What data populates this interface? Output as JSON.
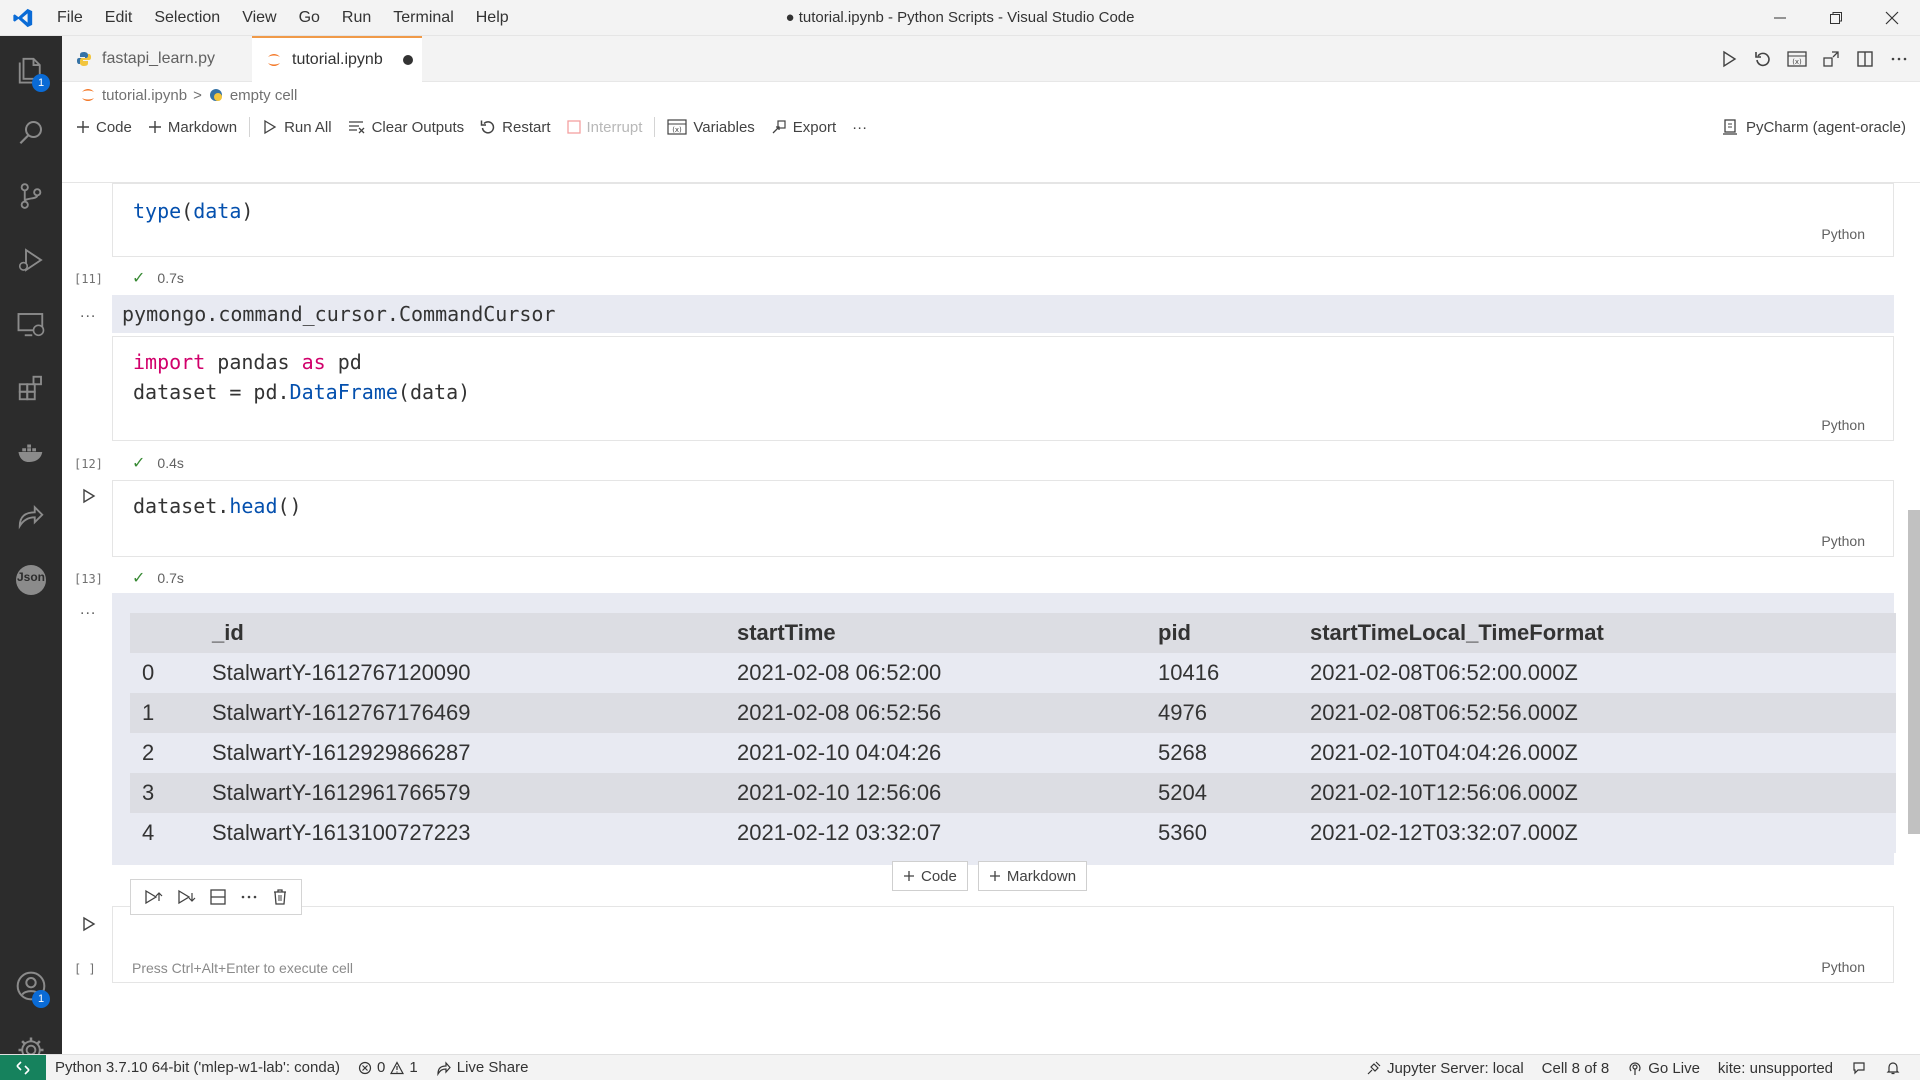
{
  "titlebar": {
    "menu": [
      "File",
      "Edit",
      "Selection",
      "View",
      "Go",
      "Run",
      "Terminal",
      "Help"
    ],
    "window_title": "● tutorial.ipynb - Python Scripts - Visual Studio Code"
  },
  "activity": {
    "explorer_badge": "1",
    "accounts_badge": "1",
    "json_label": "Json"
  },
  "tabs": [
    {
      "label": "fastapi_learn.py",
      "active": false
    },
    {
      "label": "tutorial.ipynb",
      "active": true,
      "dirty": true
    }
  ],
  "breadcrumb": {
    "file": "tutorial.ipynb",
    "sep": ">",
    "cell": "empty cell"
  },
  "toolbar": {
    "code": "Code",
    "markdown": "Markdown",
    "run_all": "Run All",
    "clear_outputs": "Clear Outputs",
    "restart": "Restart",
    "interrupt": "Interrupt",
    "variables": "Variables",
    "export": "Export",
    "more": "···",
    "kernel": "PyCharm (agent-oracle)"
  },
  "cells": [
    {
      "count": "[11]",
      "time": "0.7s",
      "lang": "Python",
      "output": "pymongo.command_cursor.CommandCursor"
    },
    {
      "count": "[12]",
      "time": "0.4s",
      "lang": "Python"
    },
    {
      "count": "[13]",
      "time": "0.7s",
      "lang": "Python"
    },
    {
      "count": "[ ]",
      "placeholder": "Press Ctrl+Alt+Enter to execute cell",
      "lang": "Python"
    }
  ],
  "output_dots": "...",
  "dataframe": {
    "columns": [
      "",
      "_id",
      "startTime",
      "pid",
      "startTimeLocal_TimeFormat"
    ],
    "rows": [
      [
        "0",
        "StalwartY-1612767120090",
        "2021-02-08 06:52:00",
        "10416",
        "2021-02-08T06:52:00.000Z"
      ],
      [
        "1",
        "StalwartY-1612767176469",
        "2021-02-08 06:52:56",
        "4976",
        "2021-02-08T06:52:56.000Z"
      ],
      [
        "2",
        "StalwartY-1612929866287",
        "2021-02-10 04:04:26",
        "5268",
        "2021-02-10T04:04:26.000Z"
      ],
      [
        "3",
        "StalwartY-1612961766579",
        "2021-02-10 12:56:06",
        "5204",
        "2021-02-10T12:56:06.000Z"
      ],
      [
        "4",
        "StalwartY-1613100727223",
        "2021-02-12 03:32:07",
        "5360",
        "2021-02-12T03:32:07.000Z"
      ]
    ]
  },
  "insert": {
    "code": "Code",
    "markdown": "Markdown"
  },
  "statusbar": {
    "interpreter": "Python 3.7.10 64-bit ('mlep-w1-lab': conda)",
    "errors": "0",
    "warnings": "1",
    "live_share": "Live Share",
    "jupyter": "Jupyter Server: local",
    "cell_pos": "Cell 8 of 8",
    "go_live": "Go Live",
    "kite": "kite: unsupported"
  },
  "colors": {
    "accent_tab": "#f09a48",
    "remote": "#16825d",
    "badge": "#0a6bd6",
    "success": "#388a34"
  }
}
